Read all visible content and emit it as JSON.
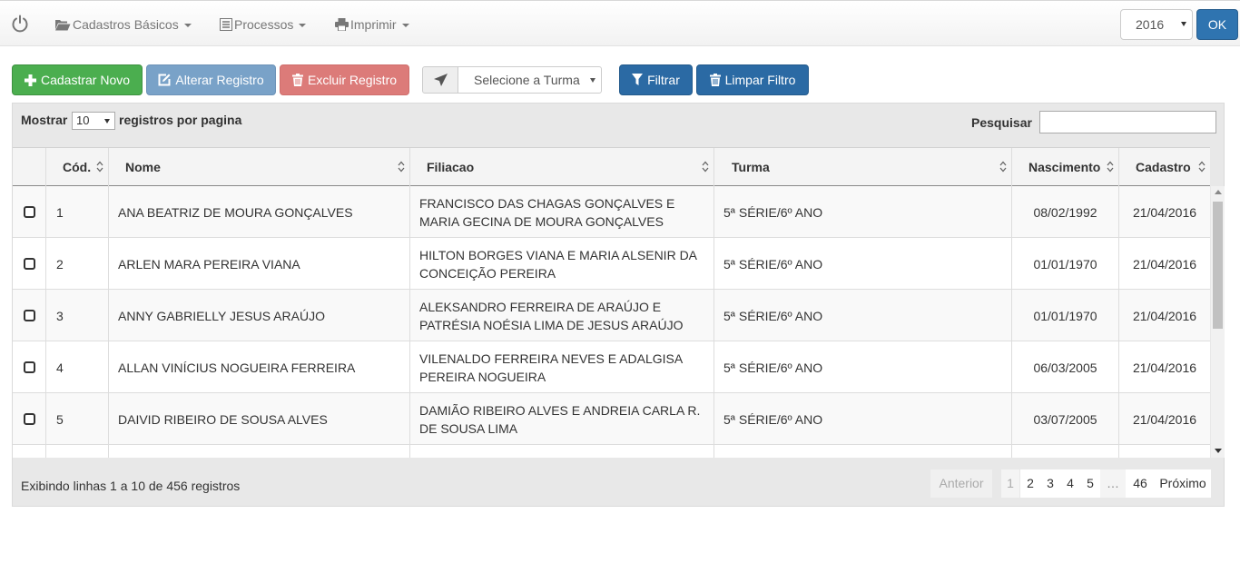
{
  "navbar": {
    "menu": [
      {
        "label": "Cadastros Básicos",
        "icon": "folder-open-icon"
      },
      {
        "label": "Processos",
        "icon": "list-icon"
      },
      {
        "label": "Imprimir",
        "icon": "print-icon"
      }
    ],
    "year_value": "2016",
    "ok_label": "OK"
  },
  "toolbar": {
    "new_label": "Cadastrar Novo",
    "edit_label": "Alterar Registro",
    "delete_label": "Excluir Registro",
    "turma_placeholder": "Selecione a Turma",
    "filter_label": "Filtrar",
    "clear_filter_label": "Limpar Filtro"
  },
  "controls": {
    "show_label": "Mostrar",
    "length_value": "10",
    "per_page_label": "registros por pagina",
    "search_label": "Pesquisar",
    "search_value": ""
  },
  "table": {
    "columns": [
      "Cód.",
      "Nome",
      "Filiacao",
      "Turma",
      "Nascimento",
      "Cadastro"
    ],
    "rows": [
      {
        "cod": "1",
        "nome": "ANA BEATRIZ DE MOURA GONÇALVES",
        "filiacao": [
          "FRANCISCO DAS CHAGAS GONÇALVES E",
          "MARIA GECINA DE MOURA GONÇALVES"
        ],
        "turma": "5ª SÉRIE/6º ANO",
        "nascimento": "08/02/1992",
        "cadastro": "21/04/2016"
      },
      {
        "cod": "2",
        "nome": "ARLEN MARA PEREIRA VIANA",
        "filiacao": [
          "HILTON BORGES VIANA E MARIA ALSENIR DA",
          "CONCEIÇÃO PEREIRA"
        ],
        "turma": "5ª SÉRIE/6º ANO",
        "nascimento": "01/01/1970",
        "cadastro": "21/04/2016"
      },
      {
        "cod": "3",
        "nome": "ANNY GABRIELLY JESUS ARAÚJO",
        "filiacao": [
          "ALEKSANDRO FERREIRA DE ARAÚJO E",
          "PATRÉSIA NOÉSIA LIMA DE JESUS ARAÚJO"
        ],
        "turma": "5ª SÉRIE/6º ANO",
        "nascimento": "01/01/1970",
        "cadastro": "21/04/2016"
      },
      {
        "cod": "4",
        "nome": "ALLAN VINÍCIUS NOGUEIRA FERREIRA",
        "filiacao": [
          "VILENALDO FERREIRA NEVES E ADALGISA",
          "PEREIRA NOGUEIRA"
        ],
        "turma": "5ª SÉRIE/6º ANO",
        "nascimento": "06/03/2005",
        "cadastro": "21/04/2016"
      },
      {
        "cod": "5",
        "nome": "DAIVID RIBEIRO DE SOUSA ALVES",
        "filiacao": [
          "DAMIÃO RIBEIRO ALVES E ANDREIA CARLA R.",
          "DE SOUSA LIMA"
        ],
        "turma": "5ª SÉRIE/6º ANO",
        "nascimento": "03/07/2005",
        "cadastro": "21/04/2016"
      }
    ]
  },
  "footer": {
    "info": "Exibindo linhas 1 a 10 de 456 registros",
    "pagination": {
      "previous": "Anterior",
      "pages": [
        "1",
        "2",
        "3",
        "4",
        "5"
      ],
      "current": "1",
      "ellipsis": "…",
      "last": "46",
      "next": "Próximo"
    }
  }
}
